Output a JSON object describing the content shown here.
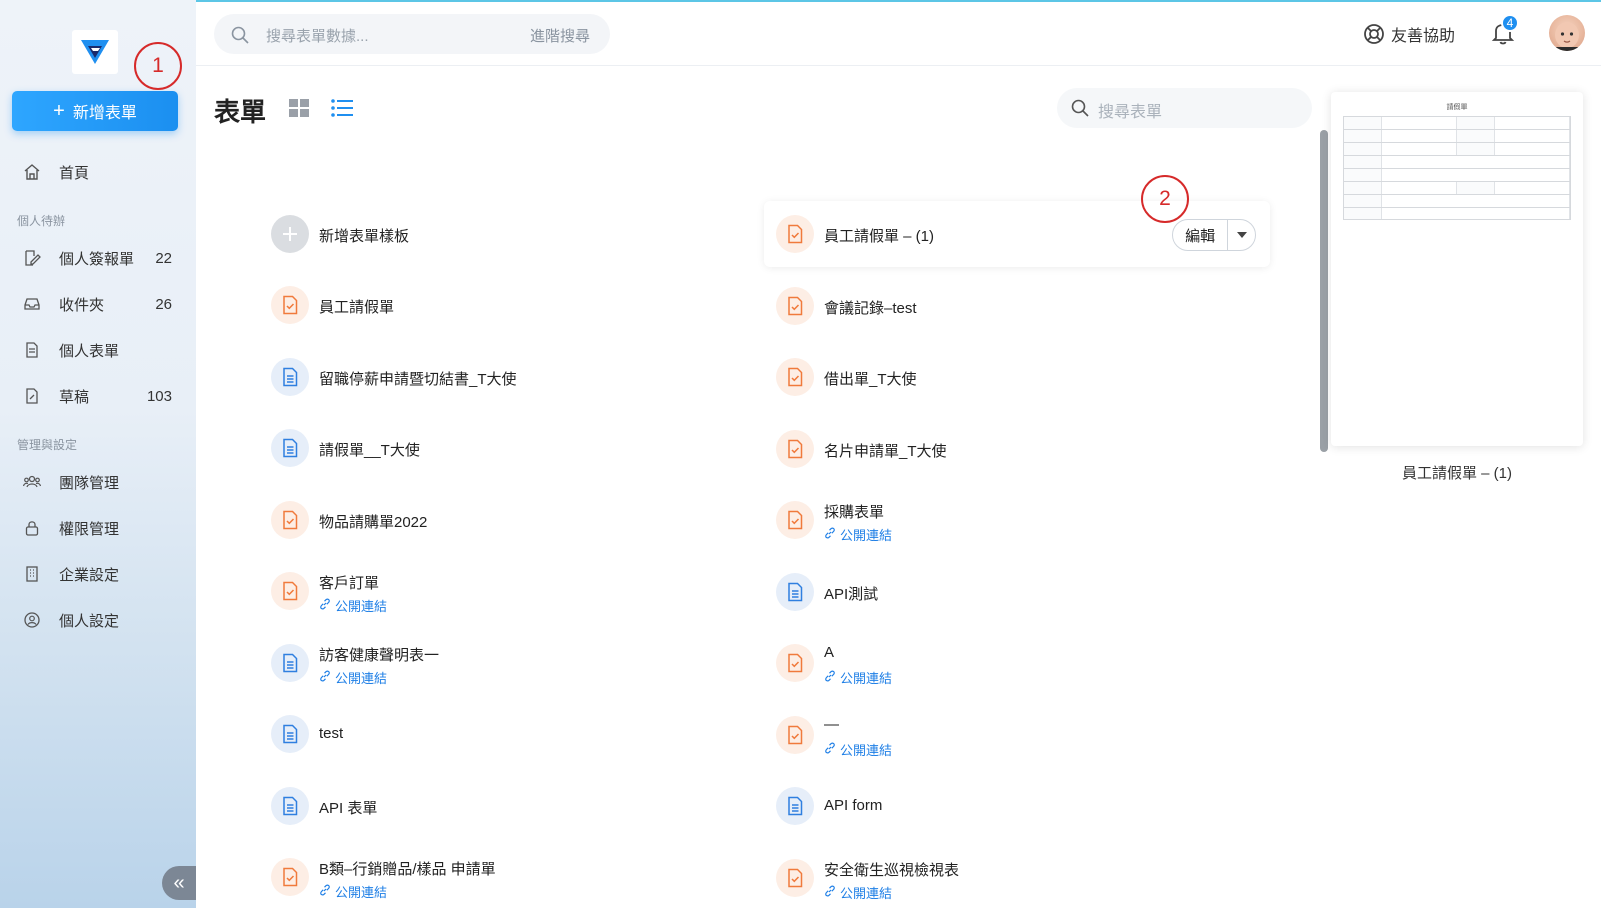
{
  "sidebar": {
    "new_form": "新增表單",
    "home": "首頁",
    "section_personal": "個人待辦",
    "items_personal": [
      {
        "label": "個人簽報單",
        "count": "22"
      },
      {
        "label": "收件夾",
        "count": "26"
      },
      {
        "label": "個人表單",
        "count": ""
      },
      {
        "label": "草稿",
        "count": "103"
      }
    ],
    "section_admin": "管理與設定",
    "items_admin": [
      {
        "label": "團隊管理"
      },
      {
        "label": "權限管理"
      },
      {
        "label": "企業設定"
      },
      {
        "label": "個人設定"
      }
    ]
  },
  "topbar": {
    "search_placeholder": "搜尋表單數據...",
    "advanced_search": "進階搜尋",
    "help": "友善協助",
    "notification_count": "4"
  },
  "main": {
    "title": "表單",
    "search_placeholder": "搜尋表單",
    "edit": "編輯",
    "new_template": "新增表單樣板",
    "left_forms": [
      {
        "name": "員工請假單",
        "type": "orange",
        "link": ""
      },
      {
        "name": "留職停薪申請暨切結書_T大使",
        "type": "blue",
        "link": ""
      },
      {
        "name": "請假單__T大使",
        "type": "blue",
        "link": ""
      },
      {
        "name": "物品請購單2022",
        "type": "orange",
        "link": ""
      },
      {
        "name": "客戶訂單",
        "type": "orange",
        "link": "公開連結"
      },
      {
        "name": "訪客健康聲明表一",
        "type": "blue",
        "link": "公開連結"
      },
      {
        "name": "test",
        "type": "blue",
        "link": ""
      },
      {
        "name": "API 表單",
        "type": "blue",
        "link": ""
      },
      {
        "name": "B類–行銷贈品/樣品 申請單",
        "type": "orange",
        "link": "公開連結"
      }
    ],
    "right_forms": [
      {
        "name": "員工請假單 – (1)",
        "type": "orange",
        "link": ""
      },
      {
        "name": "會議記錄–test",
        "type": "orange",
        "link": ""
      },
      {
        "name": "借出單_T大使",
        "type": "orange",
        "link": ""
      },
      {
        "name": "名片申請單_T大使",
        "type": "orange",
        "link": ""
      },
      {
        "name": "採購表單",
        "type": "orange",
        "link": "公開連結"
      },
      {
        "name": "API測試",
        "type": "blue",
        "link": ""
      },
      {
        "name": "A",
        "type": "orange",
        "link": "公開連結"
      },
      {
        "name": "—",
        "type": "orange",
        "link": "公開連結"
      },
      {
        "name": "API form",
        "type": "blue",
        "link": ""
      },
      {
        "name": "安全衛生巡視檢視表",
        "type": "orange",
        "link": "公開連結"
      }
    ]
  },
  "preview": {
    "doc_title": "請假單",
    "name": "員工請假單 – (1)"
  },
  "callouts": [
    "1",
    "2"
  ],
  "colors": {
    "accent": "#1f8ff0",
    "orange_icon": "#f07a3c",
    "blue_icon": "#2f7fe0",
    "callout": "#d62a2a"
  }
}
